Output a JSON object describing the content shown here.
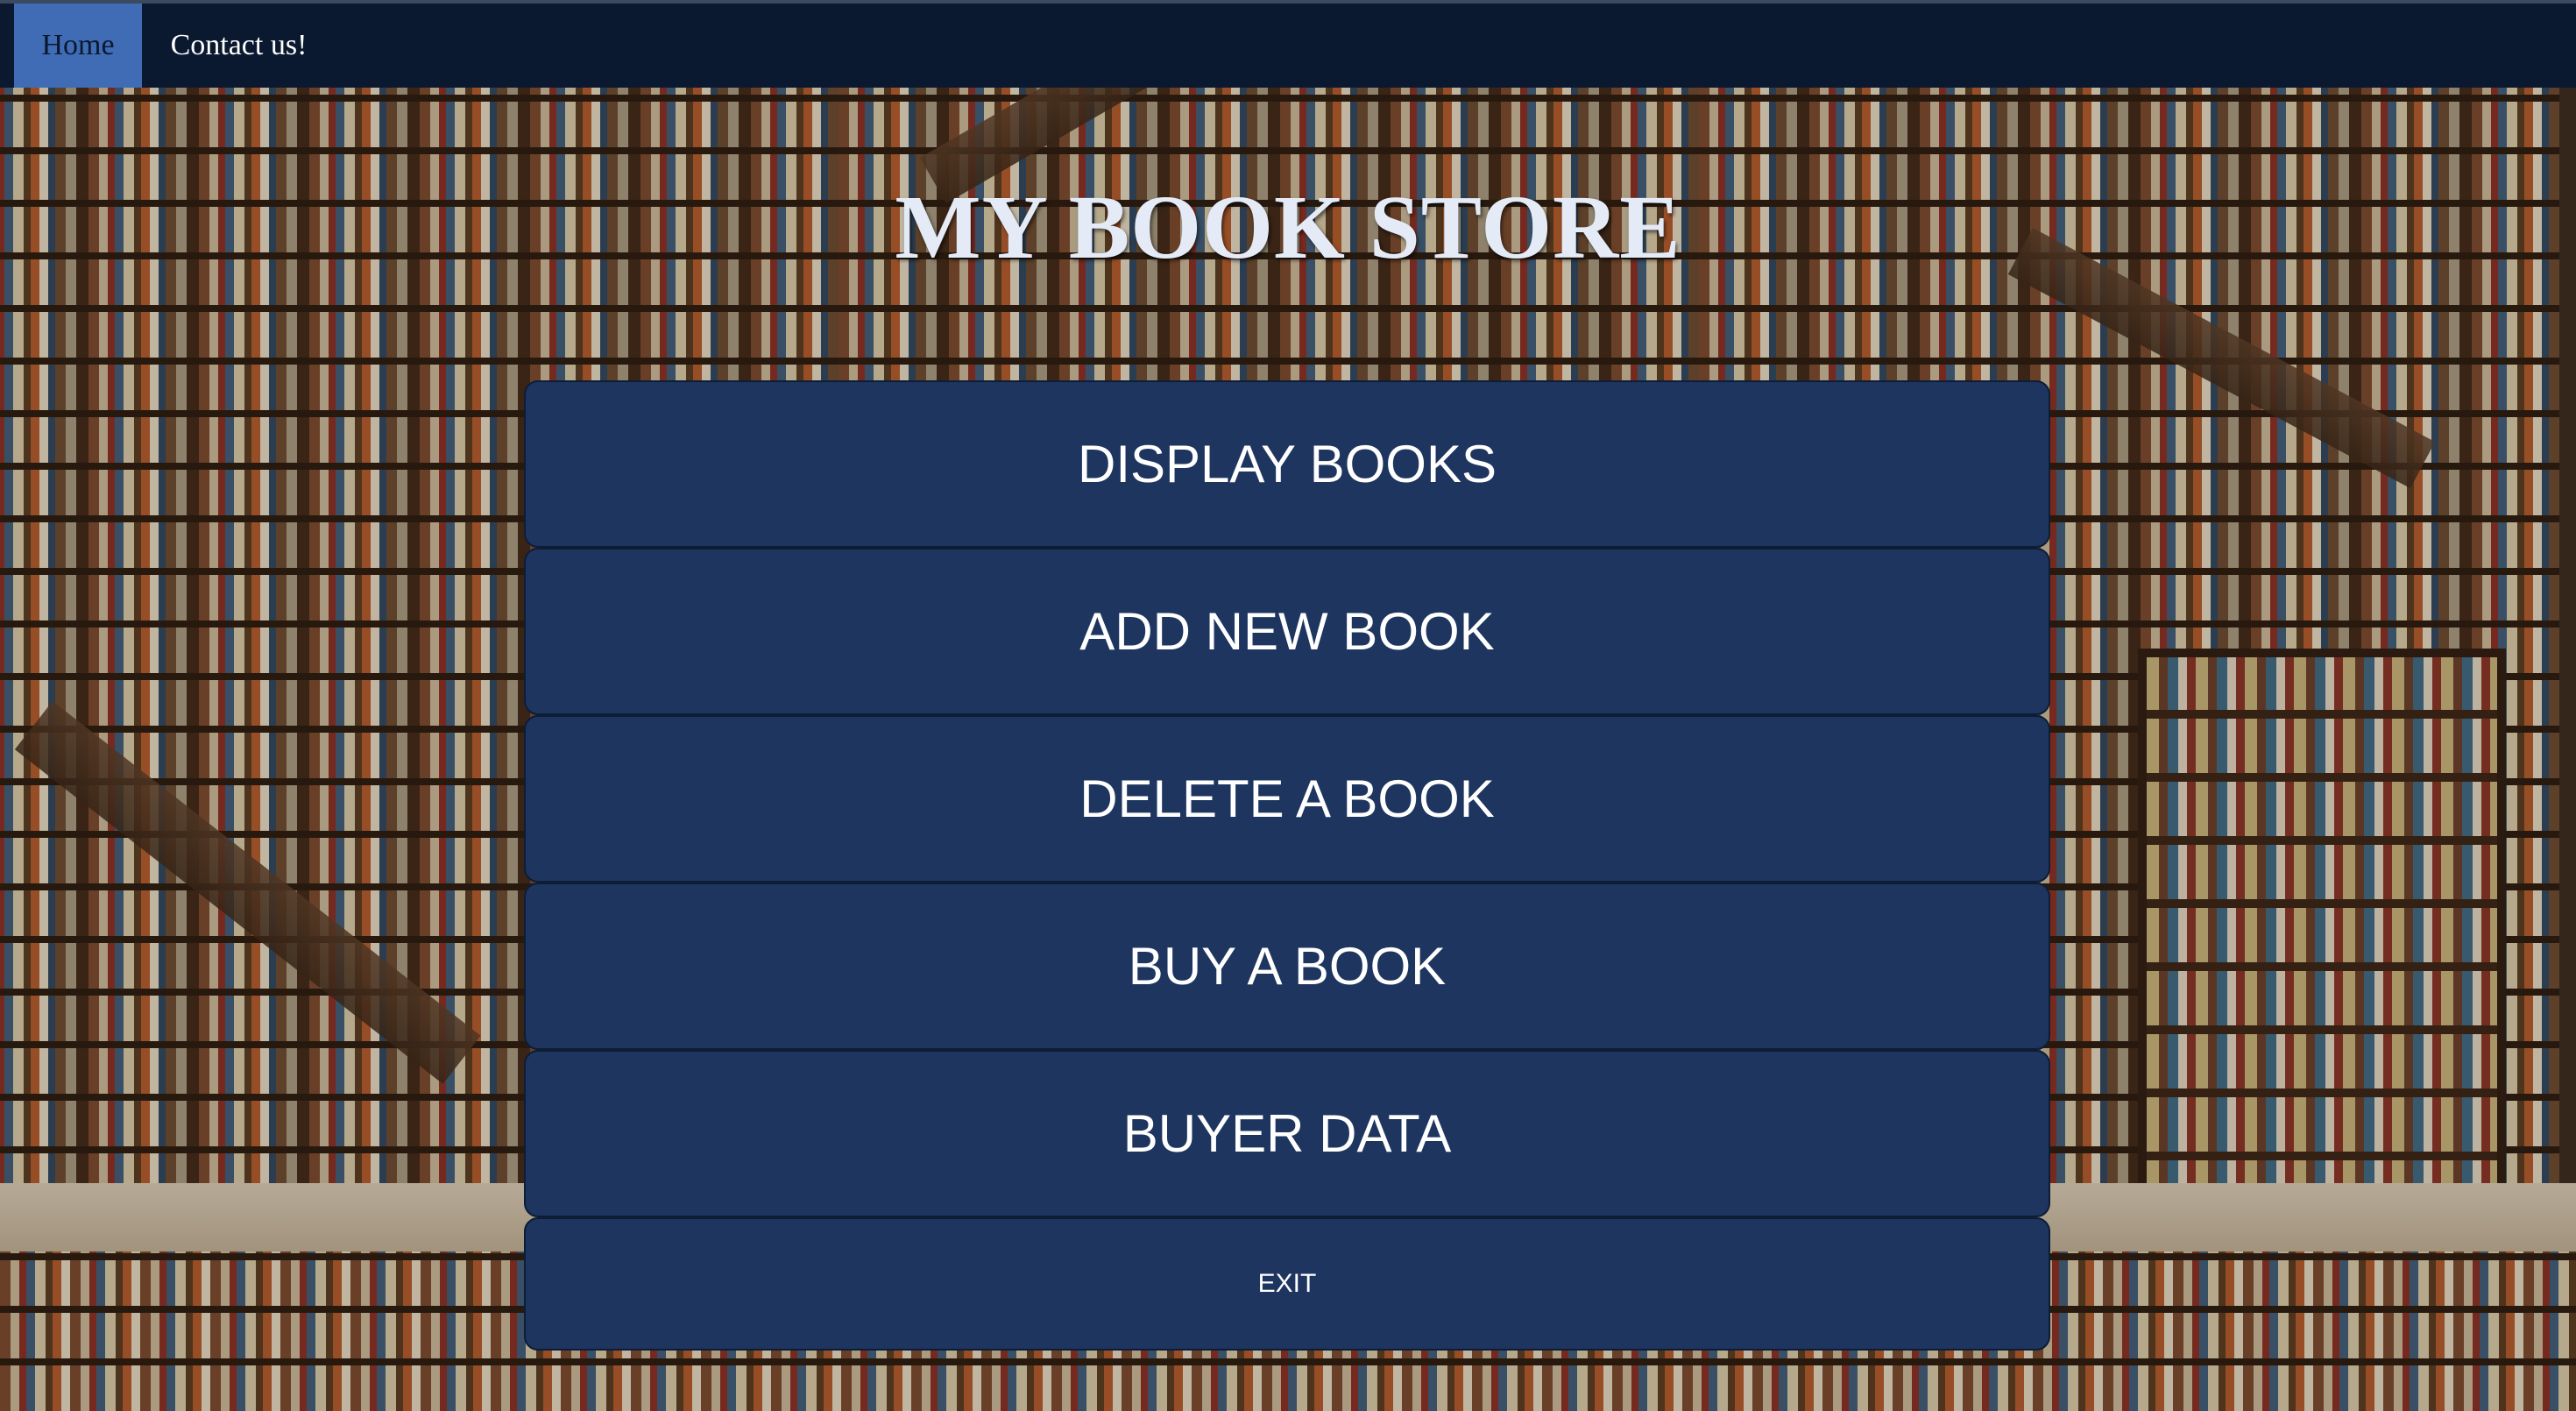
{
  "nav": {
    "items": [
      {
        "label": "Home"
      },
      {
        "label": "Contact us!"
      }
    ],
    "active_color": "#3f6cb4",
    "bar_color": "#0b1930"
  },
  "header": {
    "title": "MY BOOK STORE"
  },
  "menu": {
    "buttons": [
      {
        "label": "DISPLAY BOOKS"
      },
      {
        "label": "ADD NEW BOOK"
      },
      {
        "label": "DELETE A BOOK"
      },
      {
        "label": "BUY A BOOK"
      },
      {
        "label": "BUYER DATA"
      },
      {
        "label": "EXIT"
      }
    ],
    "button_color": "#1d355f"
  },
  "background": {
    "icon": "bookstore-staircase-photo"
  }
}
